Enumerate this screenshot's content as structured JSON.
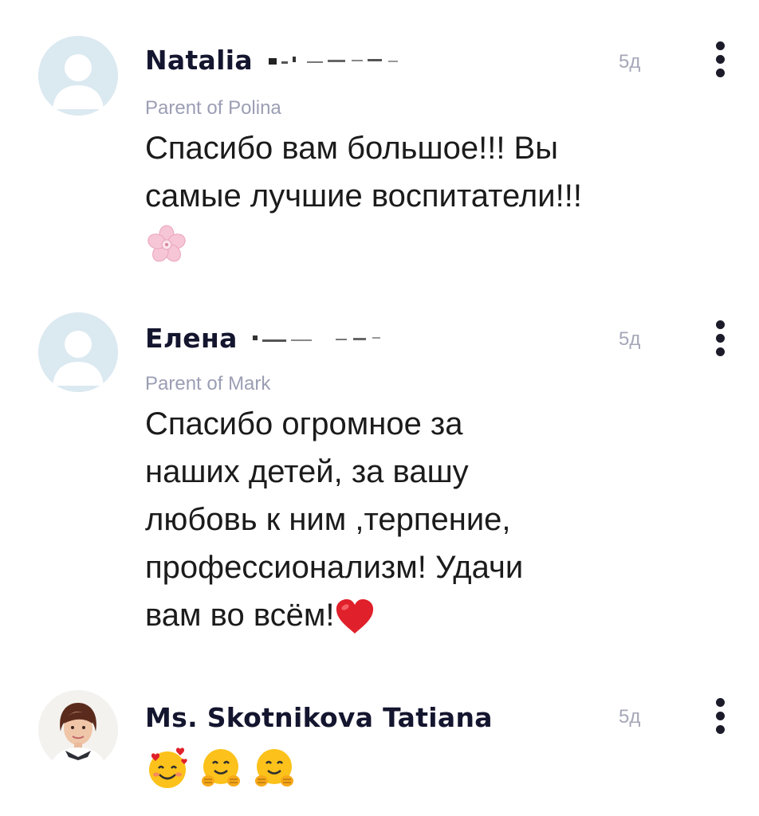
{
  "comments": [
    {
      "author": "Natalia",
      "role": "Parent of Polina",
      "time": "5д",
      "text_line1": "Спасибо вам большое!!! Вы",
      "text_line2": "самые лучшие воспитатели!!!",
      "emoji": "cherry-blossom-icon"
    },
    {
      "author": "Елена",
      "role": "Parent of Mark",
      "time": "5д",
      "text_lines": [
        "Спасибо огромное за",
        "наших детей, за вашу",
        "любовь к ним ,терпение,",
        "профессионализм! Удачи",
        "вам во всём!"
      ],
      "emoji": "red-heart-icon"
    },
    {
      "author": "Ms. Skotnikova Tatiana",
      "time": "5д",
      "emoji": [
        "smiling-face-with-hearts-icon",
        "hugging-face-icon",
        "hugging-face-icon"
      ]
    }
  ],
  "colors": {
    "name": "#14152e",
    "role": "#9b9eb4",
    "time": "#a5a7b8",
    "avatar_bg": "#dbe9f1",
    "heart": "#e0202a"
  }
}
